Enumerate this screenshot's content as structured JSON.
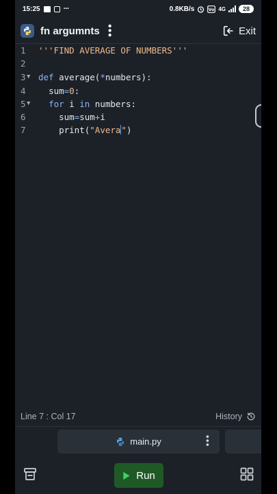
{
  "status_bar": {
    "time": "15:25",
    "network_speed": "0.8KB/s",
    "network_type": "4G",
    "battery": "28"
  },
  "header": {
    "title": "fn argumnts",
    "exit_label": "Exit"
  },
  "editor": {
    "line_numbers": [
      "1",
      "2",
      "3",
      "4",
      "5",
      "6",
      "7"
    ],
    "tokens": {
      "l1_str": "'''FIND AVERAGE OF NUMBERS'''",
      "l3_kw": "def",
      "l3_name": " average(",
      "l3_star": "*",
      "l3_rest": "numbers):",
      "l4_indent": "  ",
      "l4_a": "sum",
      "l4_eq": "=",
      "l4_num": "0",
      "l4_colon": ":",
      "l5_indent": "  ",
      "l5_kw1": "for",
      "l5_i": " i ",
      "l5_kw2": "in",
      "l5_rest": " numbers:",
      "l6_indent": "    ",
      "l6_a": "sum",
      "l6_eq": "=",
      "l6_b": "sum",
      "l6_plus": "+",
      "l6_c": "i",
      "l7_indent": "    ",
      "l7_a": "print(",
      "l7_str": "\"Avera",
      "l7_str_end": "\"",
      "l7_close": ")"
    },
    "colors": {
      "string": "#f2b98b",
      "keyword": "#8fb4f0",
      "cursor": "#4f9cf0"
    }
  },
  "info_bar": {
    "cursor_position": "Line 7 : Col 17",
    "history_label": "History"
  },
  "tabs": {
    "active_file": "main.py"
  },
  "toolbar": {
    "run_label": "Run",
    "run_color": "#1f5a26"
  }
}
